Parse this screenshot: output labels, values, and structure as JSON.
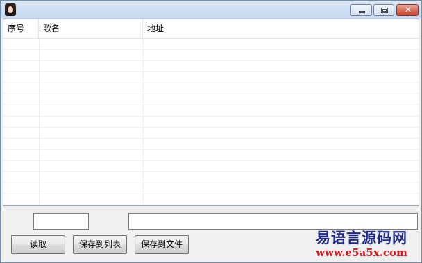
{
  "window": {
    "title": "",
    "icon": "girl-avatar-icon",
    "controls": {
      "minimize": "minimize-icon",
      "maximize": "maximize-icon",
      "close": "close-icon",
      "close_color": "#c4442c"
    }
  },
  "list": {
    "columns": [
      "序号",
      "歌名",
      "地址"
    ],
    "rows": []
  },
  "inputs": {
    "index_value": "",
    "address_value": ""
  },
  "buttons": {
    "read": "读取",
    "save_to_list": "保存到列表",
    "save_to_file": "保存到文件"
  },
  "watermark": {
    "name": "易语言源码网",
    "url": "www.e5a5x.com",
    "name_color": "#1f2a8a",
    "url_color": "#d61a1a"
  }
}
